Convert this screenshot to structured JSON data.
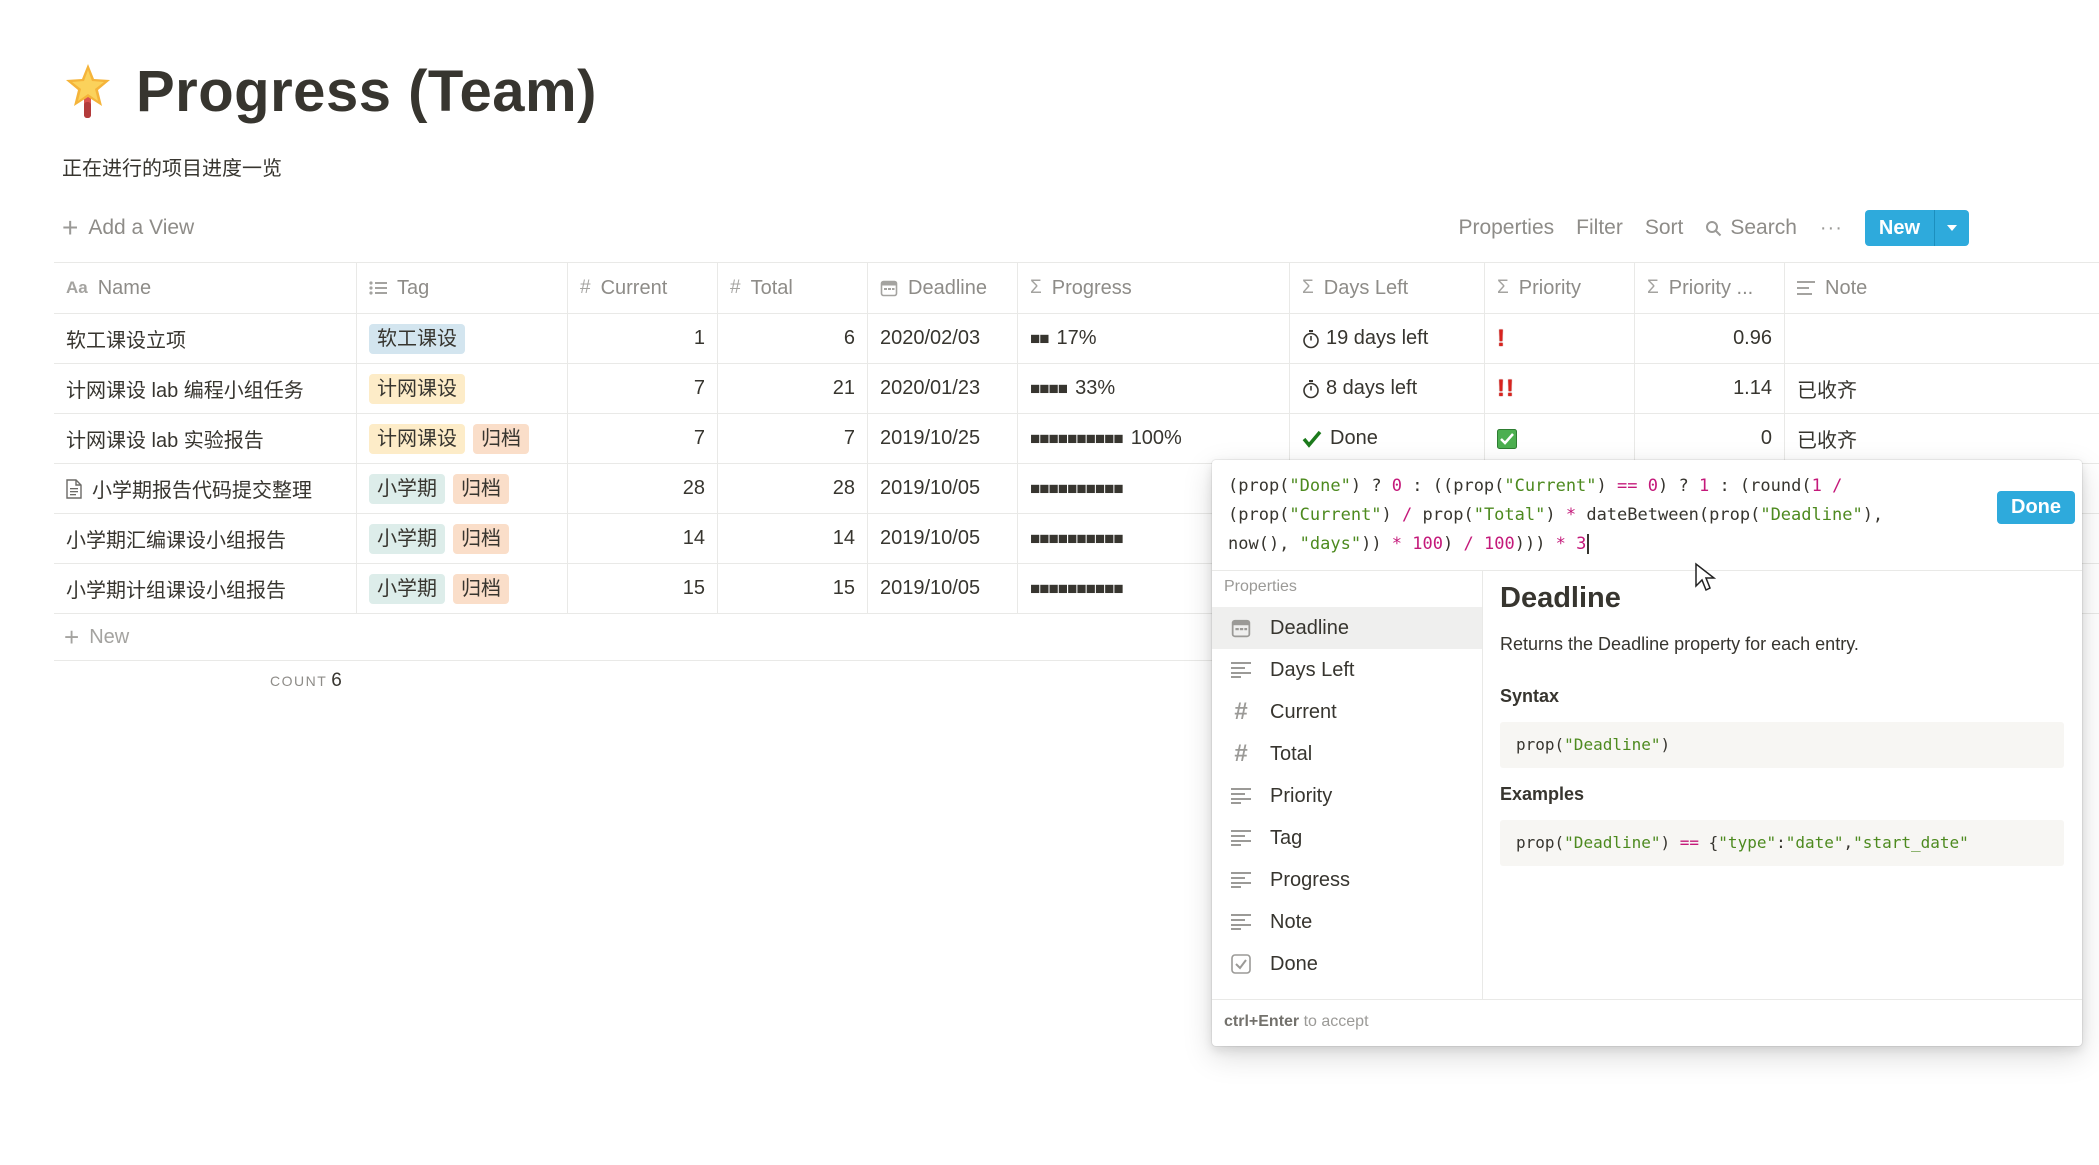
{
  "page": {
    "icon": "star-wand-icon",
    "title": "Progress (Team)",
    "description": "正在进行的项目进度一览"
  },
  "toolbar": {
    "add_view": "Add a View",
    "properties": "Properties",
    "filter": "Filter",
    "sort": "Sort",
    "search": "Search",
    "more": "···",
    "new": "New"
  },
  "table": {
    "columns": [
      {
        "label": "Name",
        "icon": "text-aa-icon"
      },
      {
        "label": "Tag",
        "icon": "list-icon"
      },
      {
        "label": "Current",
        "icon": "hash-icon"
      },
      {
        "label": "Total",
        "icon": "hash-icon"
      },
      {
        "label": "Deadline",
        "icon": "calendar-icon"
      },
      {
        "label": "Progress",
        "icon": "sigma-icon"
      },
      {
        "label": "Days Left",
        "icon": "sigma-icon"
      },
      {
        "label": "Priority",
        "icon": "sigma-icon"
      },
      {
        "label": "Priority ...",
        "icon": "sigma-icon"
      },
      {
        "label": "Note",
        "icon": "lines-icon"
      }
    ],
    "rows": [
      {
        "name": "软工课设立项",
        "tags": [
          {
            "label": "软工课设",
            "color": "#d3e5ef"
          }
        ],
        "current": "1",
        "total": "6",
        "deadline": "2020/02/03",
        "progress_bar": "■■",
        "progress": "17%",
        "days_left": "19 days left",
        "days_icon": "stopwatch-icon",
        "priority": "!",
        "priority_value": "0.96",
        "note": ""
      },
      {
        "name": "计网课设 lab 编程小组任务",
        "tags": [
          {
            "label": "计网课设",
            "color": "#fdecc8"
          }
        ],
        "current": "7",
        "total": "21",
        "deadline": "2020/01/23",
        "progress_bar": "■■■■",
        "progress": "33%",
        "days_left": "8 days left",
        "days_icon": "stopwatch-icon",
        "priority": "!!",
        "priority_value": "1.14",
        "note": "已收齐"
      },
      {
        "name": "计网课设 lab 实验报告",
        "tags": [
          {
            "label": "计网课设",
            "color": "#fdecc8"
          },
          {
            "label": "归档",
            "color": "#fadec9"
          }
        ],
        "current": "7",
        "total": "7",
        "deadline": "2019/10/25",
        "progress_bar": "■■■■■■■■■■",
        "progress": "100%",
        "days_left": "Done",
        "days_icon": "checkmark-icon",
        "priority": "✓",
        "priority_value": "0",
        "note": "已收齐"
      },
      {
        "name": "小学期报告代码提交整理",
        "tags": [
          {
            "label": "小学期",
            "color": "#ddedea"
          },
          {
            "label": "归档",
            "color": "#fadec9"
          }
        ],
        "current": "28",
        "total": "28",
        "deadline": "2019/10/05",
        "progress_bar": "■■■■■■■■■■",
        "progress": "",
        "days_left": "",
        "days_icon": "",
        "priority": "",
        "priority_value": "",
        "note": "",
        "has_page_icon": true
      },
      {
        "name": "小学期汇编课设小组报告",
        "tags": [
          {
            "label": "小学期",
            "color": "#ddedea"
          },
          {
            "label": "归档",
            "color": "#fadec9"
          }
        ],
        "current": "14",
        "total": "14",
        "deadline": "2019/10/05",
        "progress_bar": "■■■■■■■■■■",
        "progress": "",
        "days_left": "",
        "days_icon": "",
        "priority": "",
        "priority_value": "",
        "note": ""
      },
      {
        "name": "小学期计组课设小组报告",
        "tags": [
          {
            "label": "小学期",
            "color": "#ddedea"
          },
          {
            "label": "归档",
            "color": "#fadec9"
          }
        ],
        "current": "15",
        "total": "15",
        "deadline": "2019/10/05",
        "progress_bar": "■■■■■■■■■■",
        "progress": "",
        "days_left": "",
        "days_icon": "",
        "priority": "",
        "priority_value": "",
        "note": ""
      }
    ],
    "new_row": "New",
    "count_label": "COUNT",
    "count_value": "6"
  },
  "formula_popup": {
    "done_button": "Done",
    "properties_label": "Properties",
    "properties": [
      {
        "label": "Deadline",
        "icon": "calendar-icon",
        "selected": true
      },
      {
        "label": "Days Left",
        "icon": "lines-icon"
      },
      {
        "label": "Current",
        "icon": "hash-icon"
      },
      {
        "label": "Total",
        "icon": "hash-icon"
      },
      {
        "label": "Priority",
        "icon": "lines-icon"
      },
      {
        "label": "Tag",
        "icon": "lines-icon"
      },
      {
        "label": "Progress",
        "icon": "lines-icon"
      },
      {
        "label": "Note",
        "icon": "lines-icon"
      },
      {
        "label": "Done",
        "icon": "checkbox-icon"
      }
    ],
    "detail": {
      "title": "Deadline",
      "description": "Returns the Deadline property for each entry.",
      "syntax_label": "Syntax",
      "syntax_code": "prop(\"Deadline\")",
      "examples_label": "Examples",
      "example_code": "prop(\"Deadline\") == {\"type\":\"date\",\"start_date\""
    },
    "hint_key": "ctrl+Enter",
    "hint_text": "to accept"
  }
}
